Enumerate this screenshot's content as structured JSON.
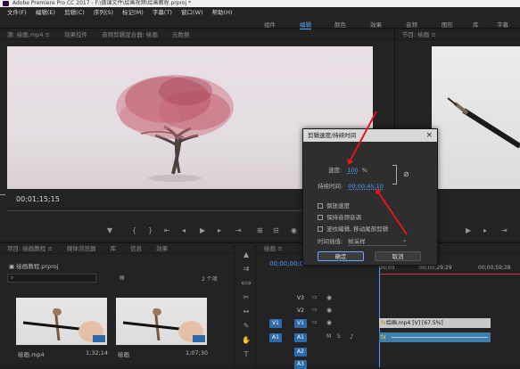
{
  "titlebar": {
    "text": "Adobe Premiere Pro CC 2017 - F:\\做课文件\\绘画视频\\绘画教程.prproj *"
  },
  "menu": [
    "文件(F)",
    "编辑(E)",
    "剪辑(C)",
    "序列(S)",
    "标记(M)",
    "字幕(T)",
    "窗口(W)",
    "帮助(H)"
  ],
  "workspaces": [
    "组件",
    "编辑",
    "颜色",
    "效果",
    "音频",
    "图形",
    "库",
    "字幕"
  ],
  "source_panel": {
    "tabs": [
      "源: 绘画.mp4 ≡",
      "效果控件",
      "音频剪辑混合器: 绘画",
      "元数据"
    ],
    "timecode": "00;01;15;15"
  },
  "program_panel": {
    "tabs": [
      "节目: 绘画 ≡"
    ]
  },
  "project_panel": {
    "tabs": [
      "项目: 绘画教程 ≡",
      "媒体浏览器",
      "库",
      "信息",
      "效果"
    ],
    "project_file": "绘画教程.prproj",
    "item_count": "2 个项",
    "items": [
      {
        "name": "绘画.mp4",
        "duration": "1;32;14"
      },
      {
        "name": "绘画",
        "duration": "1;07;30"
      }
    ]
  },
  "timeline": {
    "tab": "绘画 ≡",
    "timecode": "00;00;00;00",
    "ruler": [
      "00;00",
      "00;00;29;29",
      "00;00;59;28"
    ],
    "tracks": [
      "V3",
      "V2",
      "V1",
      "A1",
      "A2",
      "A3"
    ],
    "source_targets": [
      "V1",
      "A1"
    ],
    "video_clip": "绘画.mp4 [V] [67.5%]"
  },
  "dialog": {
    "title": "剪辑速度/持续时间",
    "speed_label": "速度:",
    "speed_value": "100",
    "speed_unit": "%",
    "duration_label": "持续时间:",
    "duration_value": "00;00;45;10",
    "options": [
      "倒放速度",
      "保持音频音调",
      "波纹编辑, 移动尾部剪辑"
    ],
    "interp_label": "时间插值:",
    "interp_value": "帧采样",
    "ok_label": "确定",
    "cancel_label": "取消"
  },
  "colors": {
    "accent_blue": "#4a9eff",
    "arrow_red": "#e0161b",
    "video_clip": "#c8c8c8",
    "audio_clip": "#3f7fa8"
  }
}
